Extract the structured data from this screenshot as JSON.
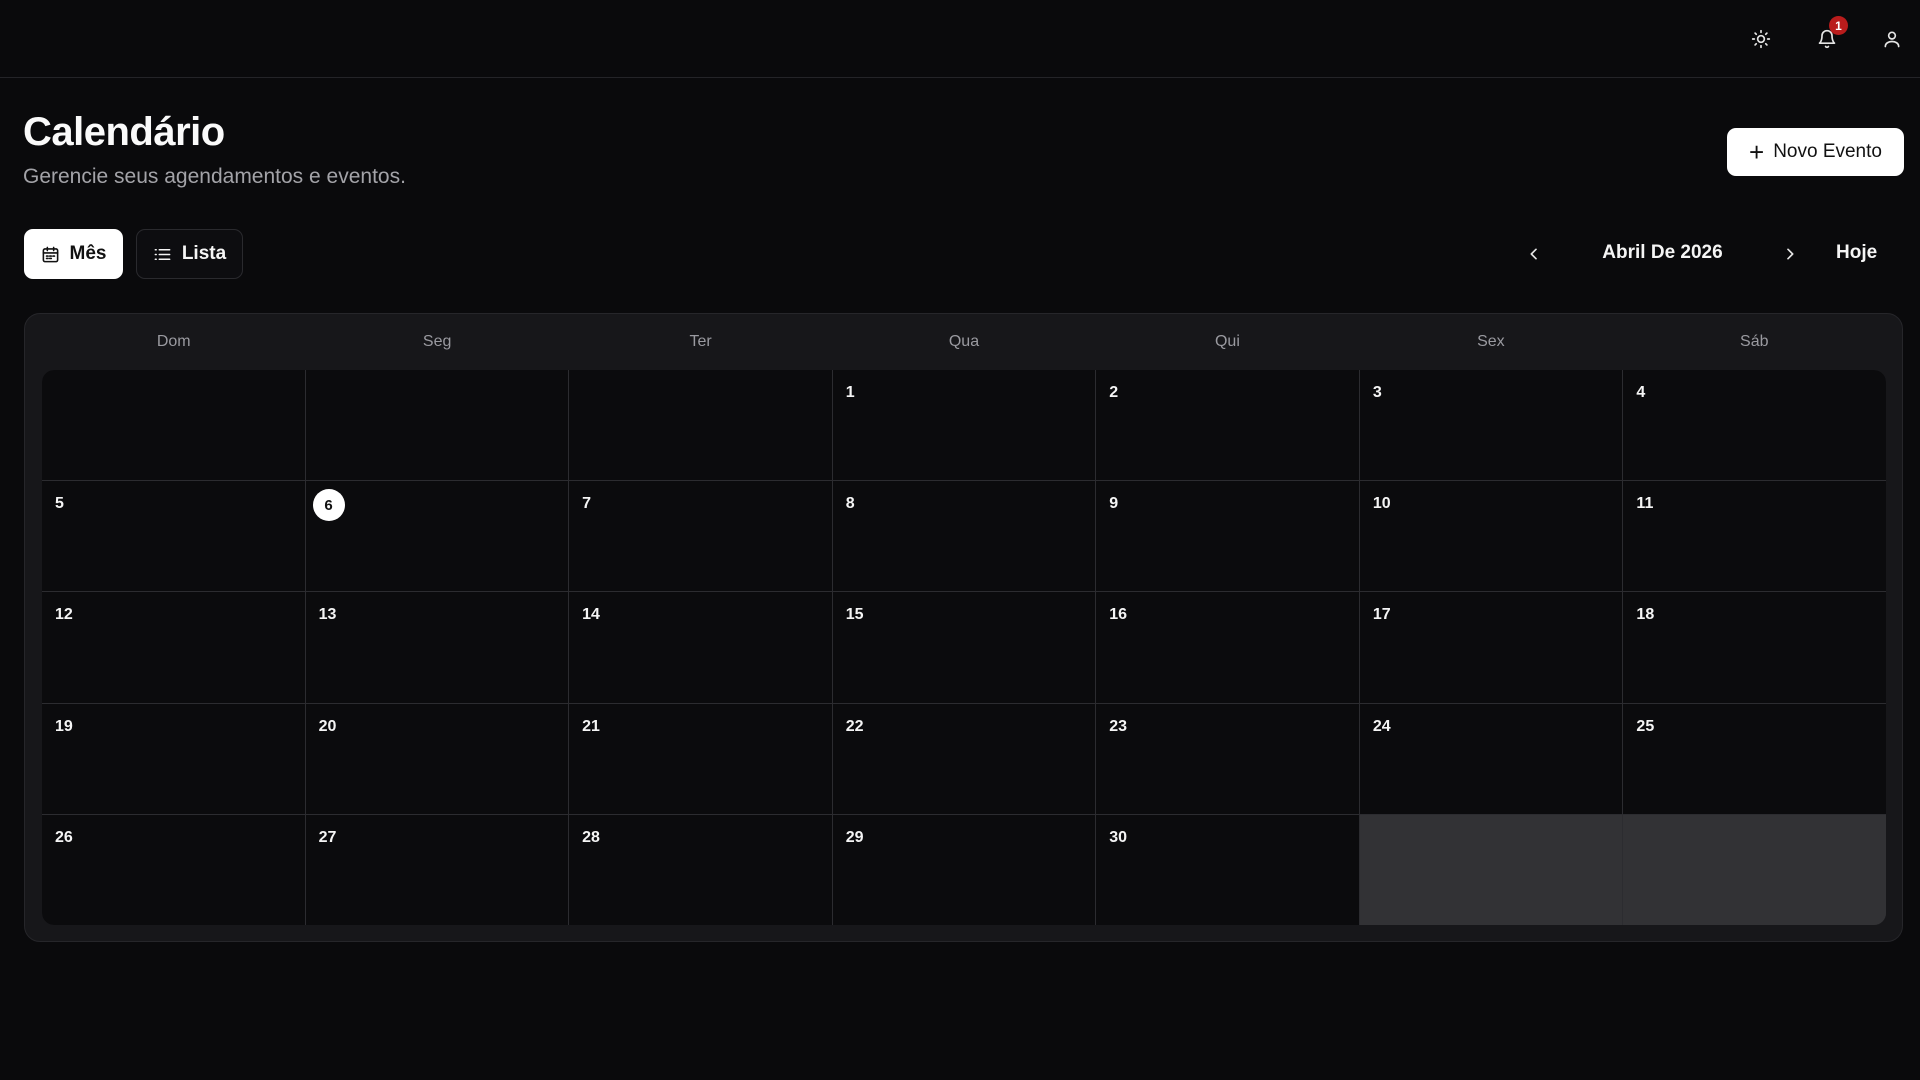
{
  "topbar": {
    "theme_icon": "sun-icon",
    "notifications_icon": "bell-icon",
    "notifications_count": "1",
    "user_icon": "user-icon"
  },
  "header": {
    "title": "Calendário",
    "subtitle": "Gerencie seus agendamentos e eventos.",
    "new_event_label": "Novo Evento"
  },
  "view_toggle": {
    "month_label": "Mês",
    "list_label": "Lista",
    "selected": "Mês"
  },
  "navigation": {
    "month_label": "Abril De 2026",
    "today_label": "Hoje"
  },
  "calendar": {
    "weekdays": [
      "Dom",
      "Seg",
      "Ter",
      "Qua",
      "Qui",
      "Sex",
      "Sáb"
    ],
    "today": "6",
    "cells": [
      "",
      "",
      "",
      "1",
      "2",
      "3",
      "4",
      "5",
      "6",
      "7",
      "8",
      "9",
      "10",
      "11",
      "12",
      "13",
      "14",
      "15",
      "16",
      "17",
      "18",
      "19",
      "20",
      "21",
      "22",
      "23",
      "24",
      "25",
      "26",
      "27",
      "28",
      "29",
      "30",
      "",
      ""
    ]
  },
  "colors": {
    "background": "#0a0a0c",
    "card": "#17171a",
    "accent": "#ffffff",
    "badge": "#b91c1c"
  }
}
